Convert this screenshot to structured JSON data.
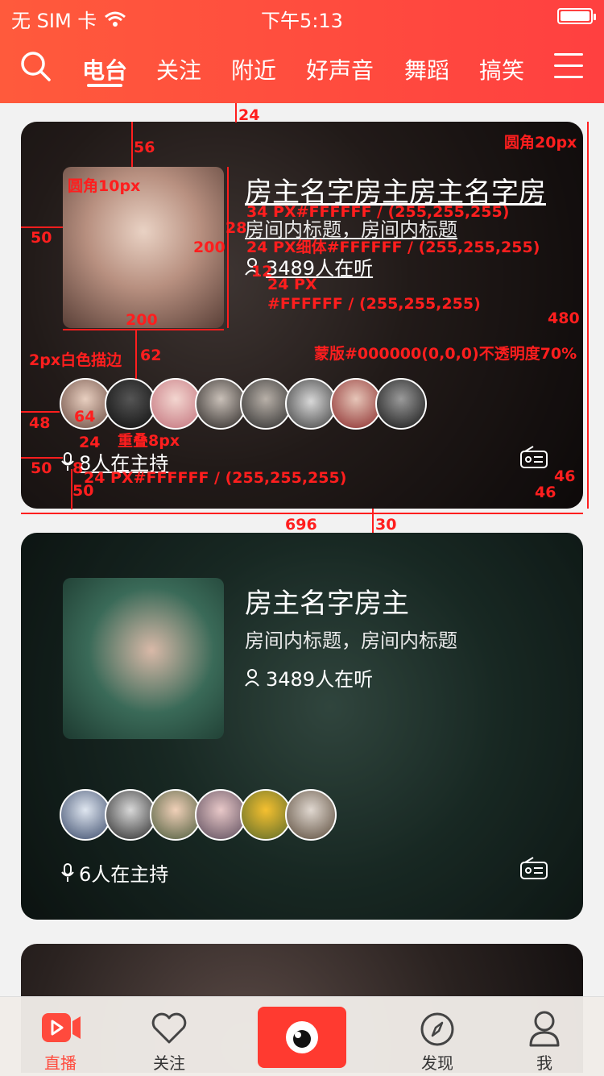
{
  "status_bar": {
    "carrier": "无 SIM 卡",
    "time": "下午5:13"
  },
  "nav": {
    "tabs": [
      {
        "label": "电台",
        "active": true
      },
      {
        "label": "关注"
      },
      {
        "label": "附近"
      },
      {
        "label": "好声音"
      },
      {
        "label": "舞蹈"
      },
      {
        "label": "搞笑"
      }
    ]
  },
  "cards": [
    {
      "title": "房主名字房主房主名字房",
      "subtitle": "房间内标题，房间内标题",
      "listeners": "3489人在听",
      "hosts": "8人在主持",
      "avatar_count": 8,
      "bg_color": "#3a2e2a"
    },
    {
      "title": "房主名字房主",
      "subtitle": "房间内标题，房间内标题",
      "listeners": "3489人在听",
      "hosts": "6人在主持",
      "avatar_count": 6,
      "bg_color": "#1f3a32"
    }
  ],
  "annotations": {
    "gap_top": "24",
    "pad_top": "56",
    "radius_card": "圆角20px",
    "radius_cover": "圆角10px",
    "pad_left": "50",
    "gap_cover_title": "28",
    "cover_h": "200",
    "cover_w": "200",
    "title_spec": "34 PX#FFFFFF / (255,255,255)",
    "sub_spec": "24 PX细体#FFFFFF / (255,255,255)",
    "gap12": "12",
    "listen_spec_1": "24 PX",
    "listen_spec_2": "#FFFFFF / (255,255,255)",
    "card_h": "480",
    "mask_spec": "蒙版#000000(0,0,0)不透明度70%",
    "gap62": "62",
    "stroke_spec": "2px白色描边",
    "pad48": "48",
    "av64": "64",
    "overlap": "重叠8px",
    "gap24": "24",
    "pad50b": "50",
    "icon_gap": "8",
    "host_spec": "24 PX#FFFFFF / (255,255,255)",
    "bottom50": "50",
    "r46a": "46",
    "r46b": "46",
    "card_w": "696",
    "gap30": "30"
  },
  "tabbar": {
    "items": [
      {
        "label": "直播",
        "icon": "live-icon",
        "active": true
      },
      {
        "label": "关注",
        "icon": "heart-icon"
      },
      {
        "label": "",
        "icon": "camera-eye-icon"
      },
      {
        "label": "发现",
        "icon": "compass-icon"
      },
      {
        "label": "我",
        "icon": "profile-icon"
      }
    ]
  },
  "colors": {
    "accent": "#ff4a3d",
    "white": "#FFFFFF"
  }
}
